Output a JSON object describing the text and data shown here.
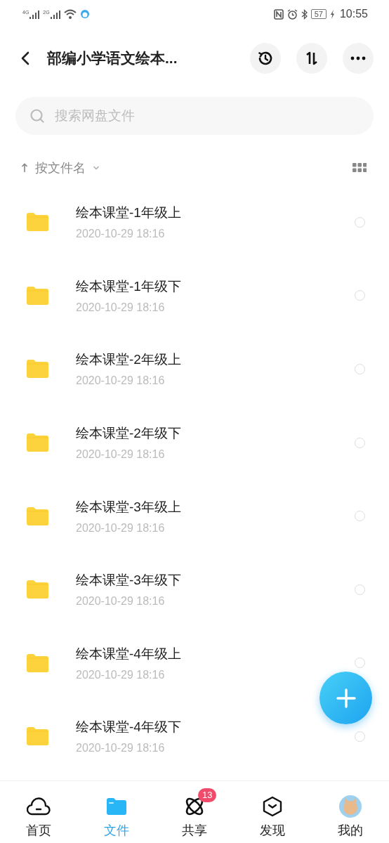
{
  "status_bar": {
    "networks": [
      "4G",
      "2G"
    ],
    "battery": "57",
    "time": "10:55"
  },
  "header": {
    "title": "部编小学语文绘本..."
  },
  "search": {
    "placeholder": "搜索网盘文件"
  },
  "sort": {
    "label": "按文件名"
  },
  "files": [
    {
      "name": "绘本课堂-1年级上",
      "date": "2020-10-29  18:16",
      "selected": false
    },
    {
      "name": "绘本课堂-1年级下",
      "date": "2020-10-29  18:16",
      "selected": false
    },
    {
      "name": "绘本课堂-2年级上",
      "date": "2020-10-29  18:16",
      "selected": false
    },
    {
      "name": "绘本课堂-2年级下",
      "date": "2020-10-29  18:16",
      "selected": false
    },
    {
      "name": "绘本课堂-3年级上",
      "date": "2020-10-29  18:16",
      "selected": false
    },
    {
      "name": "绘本课堂-3年级下",
      "date": "2020-10-29  18:16",
      "selected": false
    },
    {
      "name": "绘本课堂-4年级上",
      "date": "2020-10-29  18:16",
      "selected": false
    },
    {
      "name": "绘本课堂-4年级下",
      "date": "2020-10-29  18:16",
      "selected": false
    }
  ],
  "tabs": [
    {
      "kind": "home",
      "label": "首页",
      "selected": false
    },
    {
      "kind": "files",
      "label": "文件",
      "selected": true
    },
    {
      "kind": "share",
      "label": "共享",
      "selected": false,
      "badge": "13"
    },
    {
      "kind": "discover",
      "label": "发现",
      "selected": false
    },
    {
      "kind": "me",
      "label": "我的",
      "selected": false
    }
  ]
}
